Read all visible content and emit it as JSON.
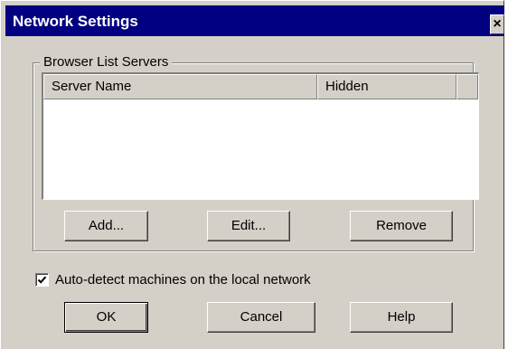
{
  "window": {
    "title": "Network Settings",
    "close_glyph": "×"
  },
  "group": {
    "label": "Browser List Servers"
  },
  "list": {
    "columns": [
      "Server Name",
      "Hidden"
    ],
    "rows": []
  },
  "list_buttons": {
    "add": "Add...",
    "edit": "Edit...",
    "remove": "Remove"
  },
  "option": {
    "auto_detect_label": "Auto-detect machines on the local network",
    "auto_detect_checked": true
  },
  "dialog_buttons": {
    "ok": "OK",
    "cancel": "Cancel",
    "help": "Help"
  },
  "colors": {
    "title_bar": "#000080",
    "face": "#d4d0c8"
  }
}
